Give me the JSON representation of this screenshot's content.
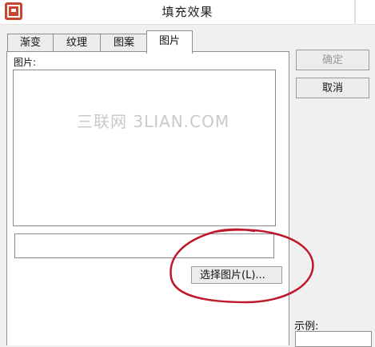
{
  "window": {
    "title": "填充效果"
  },
  "tabs": [
    {
      "label": "渐变"
    },
    {
      "label": "纹理"
    },
    {
      "label": "图案"
    },
    {
      "label": "图片",
      "active": true
    }
  ],
  "picture_panel": {
    "label": "图片:",
    "path_value": "",
    "select_button": "选择图片(L)..."
  },
  "buttons": {
    "ok": "确定",
    "cancel": "取消"
  },
  "sample": {
    "label": "示例:"
  },
  "watermark": "三联网 3LIAN.COM",
  "colors": {
    "app_icon": "#c9452f",
    "annotation": "#c0182b"
  }
}
